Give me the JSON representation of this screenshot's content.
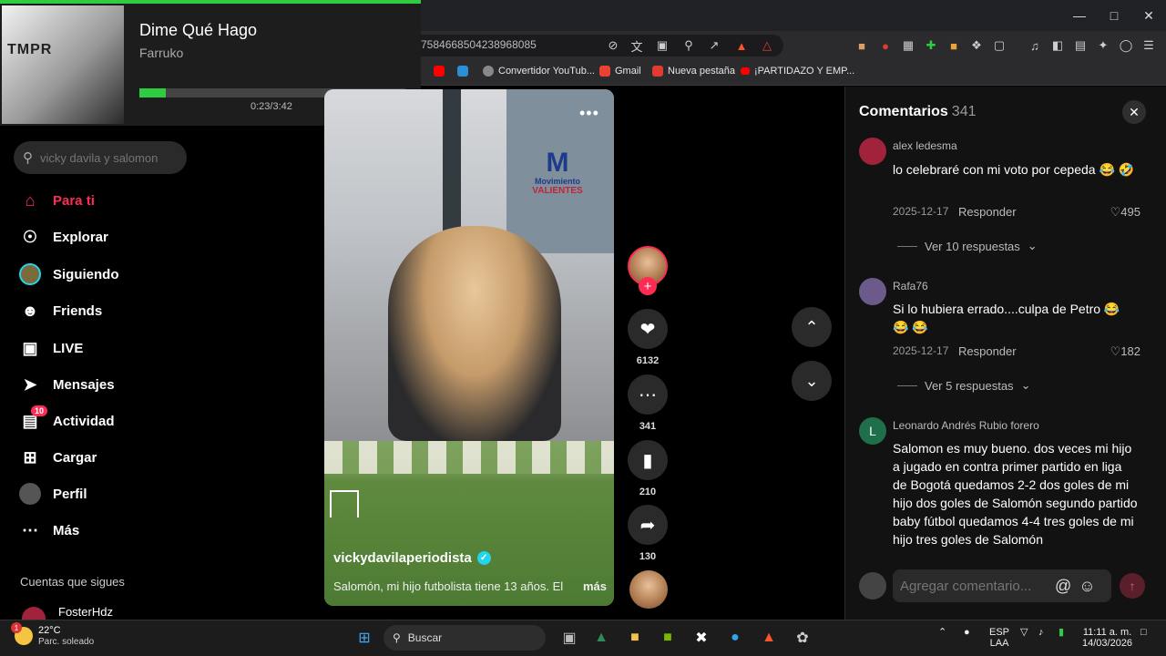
{
  "browser": {
    "url_fragment": "7584668504238968085",
    "bookmarks": [
      {
        "label": "Convertidor YouTub...",
        "color": "#888888"
      },
      {
        "label": "Gmail",
        "color": "#ea4335"
      },
      {
        "label": "Nueva pestaña",
        "color": "#e03c31"
      },
      {
        "label": "¡PARTIDAZO Y EMP...",
        "color": "#ff0000"
      }
    ]
  },
  "media": {
    "album_logo": "TMPR",
    "title": "Dime Qué Hago",
    "artist": "Farruko",
    "time": "0:23/3:42",
    "progress_fraction": 0.1,
    "accent": "#2ecc40"
  },
  "sidebar": {
    "search_placeholder": "vicky davila y salomon",
    "items": [
      {
        "label": "Para ti",
        "icon": "home-icon",
        "active": true
      },
      {
        "label": "Explorar",
        "icon": "compass-icon"
      },
      {
        "label": "Siguiendo",
        "icon": "following-avatar-icon"
      },
      {
        "label": "Friends",
        "icon": "friends-icon"
      },
      {
        "label": "LIVE",
        "icon": "live-tv-icon"
      },
      {
        "label": "Mensajes",
        "icon": "send-icon"
      },
      {
        "label": "Actividad",
        "icon": "activity-icon",
        "badge": "10"
      },
      {
        "label": "Cargar",
        "icon": "upload-plus-icon"
      },
      {
        "label": "Perfil",
        "icon": "profile-avatar-icon"
      },
      {
        "label": "Más",
        "icon": "more-dots-icon"
      }
    ],
    "following_section": "Cuentas que sigues",
    "following": [
      "FosterHdz"
    ]
  },
  "video": {
    "logo_top": "Movimiento",
    "logo_bottom": "VALIENTES",
    "author": "vickydavilaperiodista",
    "caption": "Salomón, mi hijo futbolista tiene 13 años. El",
    "more": "más",
    "likes": "6132",
    "comments": "341",
    "saves": "210",
    "shares": "130"
  },
  "comments": {
    "title": "Comentarios",
    "count": "341",
    "input_placeholder": "Agregar comentario...",
    "list": [
      {
        "user": "alex ledesma",
        "text": "lo celebraré con mi voto por cepeda 😂 🤣",
        "date": "2025-12-17",
        "reply": "Responder",
        "likes": "495",
        "view_replies": "Ver 10 respuestas",
        "avatar_color": "#a0233b"
      },
      {
        "user": "Rafa76",
        "text": "Si lo hubiera errado....culpa de Petro 😂 😂 😂",
        "date": "2025-12-17",
        "reply": "Responder",
        "likes": "182",
        "view_replies": "Ver 5 respuestas",
        "avatar_color": "#6b5a8a"
      },
      {
        "user": "Leonardo Andrés Rubio forero",
        "avatar_letter": "L",
        "text": "Salomon es muy bueno. dos veces mi hijo a jugado en contra primer partido en liga de Bogotá quedamos 2-2 dos goles de mi hijo dos goles de Salomón segundo partido baby fútbol quedamos 4-4 tres goles de mi hijo tres goles de Salomón",
        "avatar_color": "#1f6f4a"
      }
    ]
  },
  "taskbar": {
    "weather_temp": "22°C",
    "weather_desc": "Parc. soleado",
    "weather_badge": "1",
    "search_label": "Buscar",
    "lang_top": "ESP",
    "lang_bottom": "LAA",
    "time": "11:11 a. m.",
    "date": "14/03/2026"
  }
}
